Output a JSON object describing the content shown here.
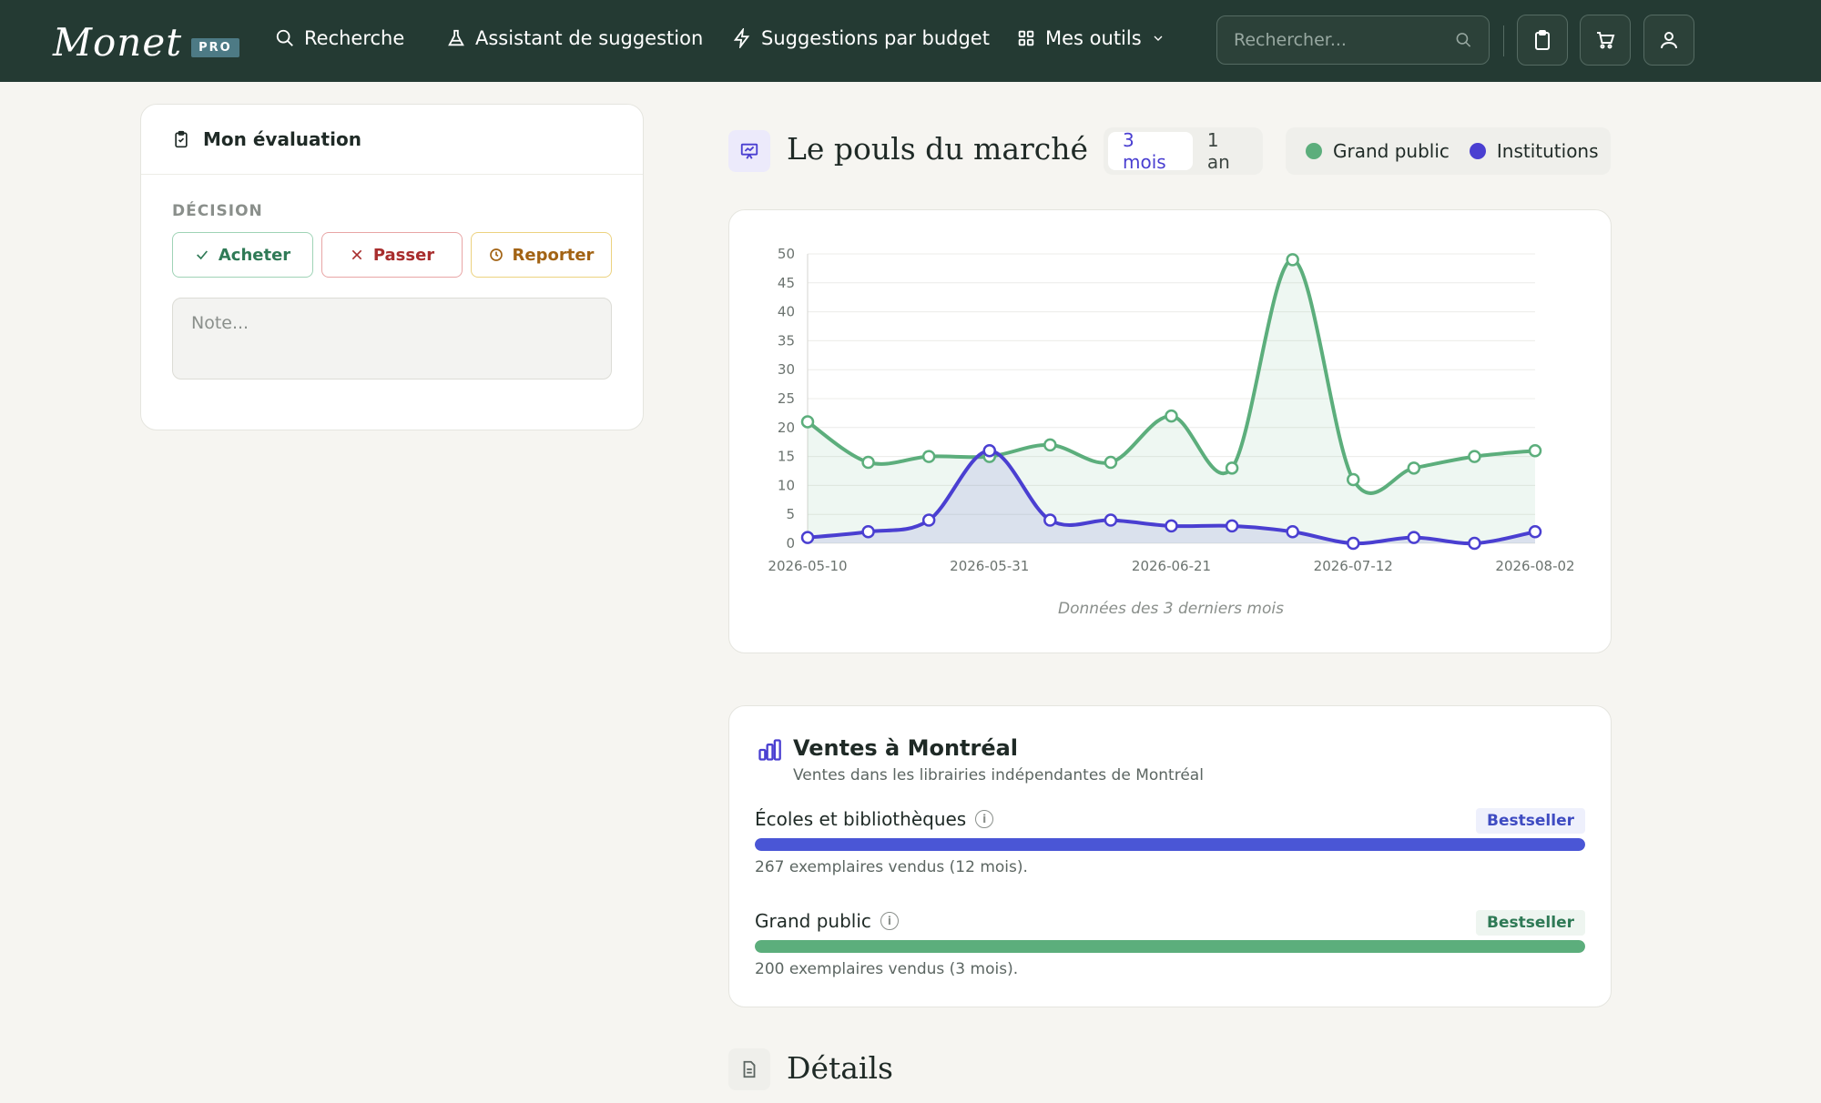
{
  "nav": {
    "logo": "Monet",
    "logo_badge": "PRO",
    "links": {
      "search": "Recherche",
      "assistant": "Assistant de suggestion",
      "budget": "Suggestions par budget",
      "tools": "Mes outils"
    },
    "search_placeholder": "Rechercher..."
  },
  "evaluation": {
    "title": "Mon évaluation",
    "decision_label": "DÉCISION",
    "buy": "Acheter",
    "pass": "Passer",
    "later": "Reporter",
    "note_placeholder": "Note..."
  },
  "market": {
    "title": "Le pouls du marché",
    "ranges": [
      "3 mois",
      "1 an"
    ],
    "active_range": "3 mois",
    "caption": "Données des 3 derniers mois"
  },
  "chart_data": {
    "type": "line",
    "x": [
      "2026-05-10",
      "2026-05-17",
      "2026-05-24",
      "2026-05-31",
      "2026-06-07",
      "2026-06-14",
      "2026-06-21",
      "2026-06-28",
      "2026-07-05",
      "2026-07-12",
      "2026-07-19",
      "2026-07-26",
      "2026-08-02"
    ],
    "x_tick_labels": [
      "2026-05-10",
      "2026-05-31",
      "2026-06-21",
      "2026-07-12",
      "2026-08-02"
    ],
    "ylim": [
      0,
      50
    ],
    "y_ticks": [
      0,
      5,
      10,
      15,
      20,
      25,
      30,
      35,
      40,
      45,
      50
    ],
    "grid": true,
    "legend_position": "top-right",
    "series": [
      {
        "name": "Grand public",
        "color": "#5cae7c",
        "values": [
          21,
          14,
          15,
          15,
          17,
          14,
          22,
          13,
          49,
          11,
          13,
          15,
          16
        ]
      },
      {
        "name": "Institutions",
        "color": "#4a3fd1",
        "values": [
          1,
          2,
          4,
          16,
          4,
          4,
          3,
          3,
          2,
          0,
          1,
          0,
          2
        ]
      }
    ]
  },
  "sales": {
    "title": "Ventes à Montréal",
    "subtitle": "Ventes dans les librairies indépendantes de Montréal",
    "metrics": [
      {
        "label": "Écoles et bibliothèques",
        "badge": "Bestseller",
        "desc": "267 exemplaires vendus (12 mois).",
        "fill": 1.0,
        "color": "#4a56d6"
      },
      {
        "label": "Grand public",
        "badge": "Bestseller",
        "desc": "200 exemplaires vendus (3 mois).",
        "fill": 1.0,
        "color": "#5cae7c"
      }
    ]
  },
  "details": {
    "title": "Détails"
  }
}
